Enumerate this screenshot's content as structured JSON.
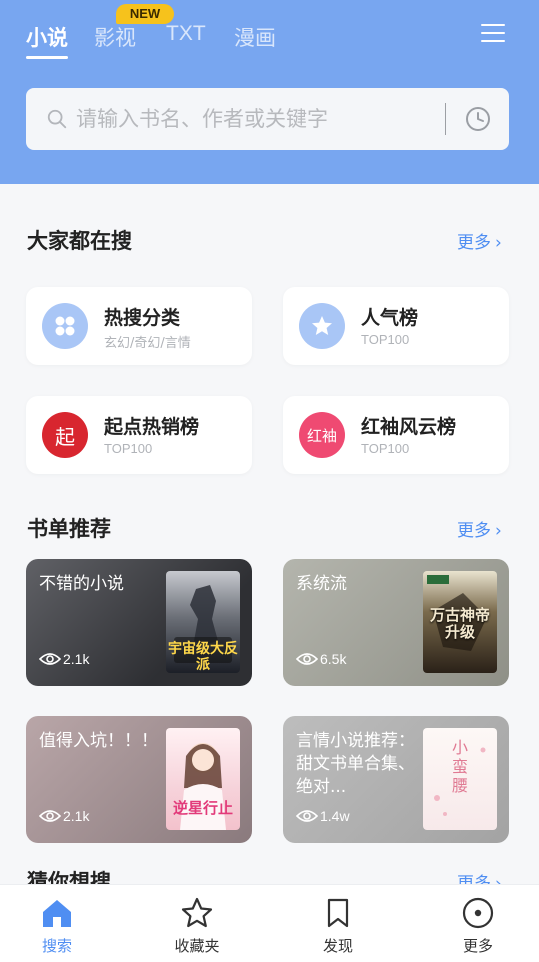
{
  "header": {
    "tabs": [
      {
        "label": "小说"
      },
      {
        "label": "影视"
      },
      {
        "label": "TXT"
      },
      {
        "label": "漫画"
      }
    ],
    "new_badge": "NEW"
  },
  "search": {
    "placeholder": "请输入书名、作者或关键字"
  },
  "popular": {
    "title": "大家都在搜",
    "more": "更多",
    "cards": [
      {
        "title": "热搜分类",
        "subtitle": "玄幻/奇幻/言情"
      },
      {
        "title": "人气榜",
        "subtitle": "TOP100"
      },
      {
        "title": "起点热销榜",
        "subtitle": "TOP100",
        "icon_text": "起"
      },
      {
        "title": "红袖风云榜",
        "subtitle": "TOP100",
        "icon_text": "红袖"
      }
    ]
  },
  "booklists": {
    "title": "书单推荐",
    "more": "更多",
    "cards": [
      {
        "title": "不错的小说",
        "views": "2.1k",
        "cover_text": "宇宙级大反派"
      },
      {
        "title": "系统流",
        "views": "6.5k",
        "cover_text": "万古神帝升级"
      },
      {
        "title": "值得入坑！！！",
        "views": "2.1k",
        "cover_text": "逆星行止"
      },
      {
        "title": "言情小说推荐：甜文书单合集、绝对...",
        "views": "1.4w",
        "cover_text": "小蛮腰"
      }
    ]
  },
  "guess": {
    "title": "猜你想搜",
    "more": "更多"
  },
  "bottom_nav": [
    {
      "label": "搜索",
      "icon": "home-icon"
    },
    {
      "label": "收藏夹",
      "icon": "star-icon"
    },
    {
      "label": "发现",
      "icon": "bookmark-icon"
    },
    {
      "label": "更多",
      "icon": "circle-dot-icon"
    }
  ],
  "colors": {
    "header_bg": "#78a6f0",
    "accent": "#4f8ef2",
    "badge": "#f6c21c",
    "qidian_red": "#d8262f",
    "hongxiu_pink": "#ef4a72"
  }
}
